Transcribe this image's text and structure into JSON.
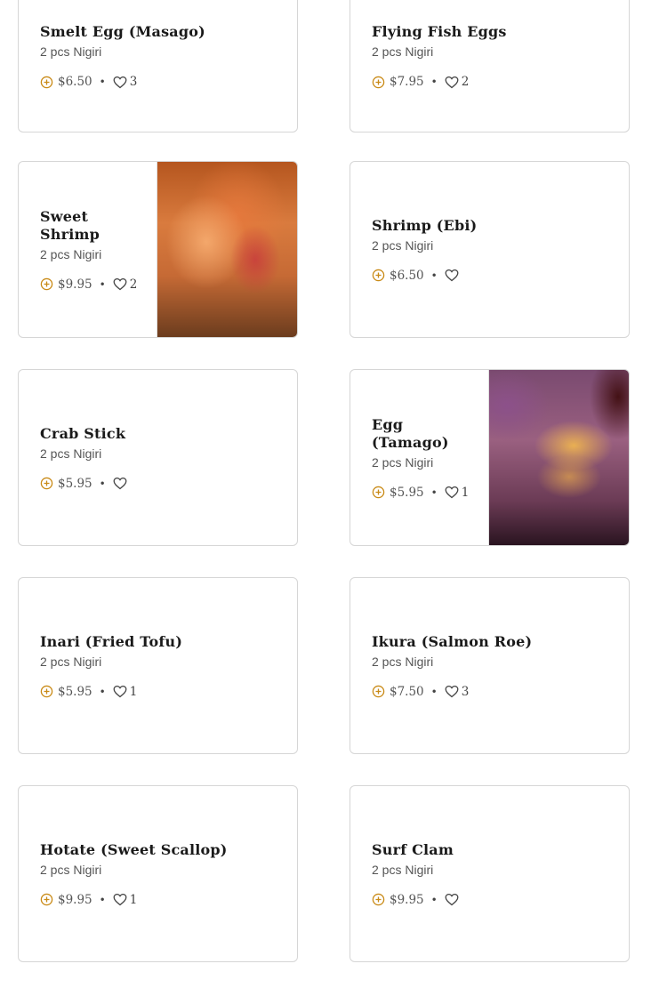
{
  "items": [
    {
      "name": "Smelt Egg (Masago)",
      "desc": "2 pcs Nigiri",
      "price": "$6.50",
      "likes": "3"
    },
    {
      "name": "Flying Fish Eggs",
      "desc": "2 pcs Nigiri",
      "price": "$7.95",
      "likes": "2"
    },
    {
      "name": "Sweet Shrimp",
      "desc": "2 pcs Nigiri",
      "price": "$9.95",
      "likes": "2",
      "photo": "shrimp"
    },
    {
      "name": "Shrimp (Ebi)",
      "desc": "2 pcs Nigiri",
      "price": "$6.50",
      "likes": ""
    },
    {
      "name": "Crab Stick",
      "desc": "2 pcs Nigiri",
      "price": "$5.95",
      "likes": ""
    },
    {
      "name": "Egg (Tamago)",
      "desc": "2 pcs Nigiri",
      "price": "$5.95",
      "likes": "1",
      "photo": "egg"
    },
    {
      "name": "Inari (Fried Tofu)",
      "desc": "2 pcs Nigiri",
      "price": "$5.95",
      "likes": "1"
    },
    {
      "name": "Ikura (Salmon Roe)",
      "desc": "2 pcs Nigiri",
      "price": "$7.50",
      "likes": "3"
    },
    {
      "name": "Hotate (Sweet Scallop)",
      "desc": "2 pcs Nigiri",
      "price": "$9.95",
      "likes": "1"
    },
    {
      "name": "Surf Clam",
      "desc": "2 pcs Nigiri",
      "price": "$9.95",
      "likes": ""
    }
  ],
  "separator": "•",
  "colors": {
    "accent": "#c98a16",
    "border": "#d6d6d6"
  },
  "icons": {
    "add": "plus-circle-icon",
    "like": "heart-icon"
  }
}
